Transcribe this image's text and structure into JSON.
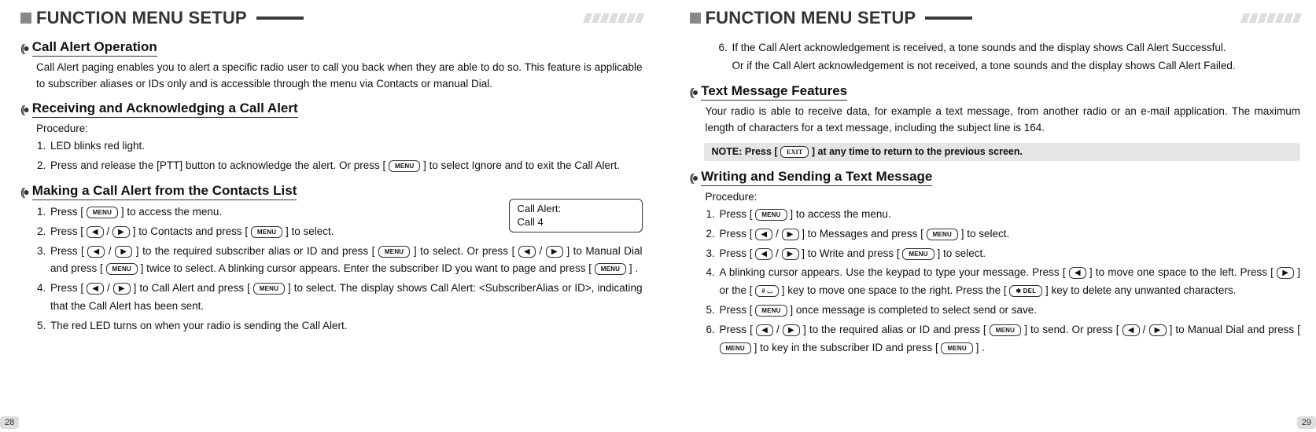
{
  "icons": {
    "menu": "MENU",
    "left": "◀",
    "right": "▶",
    "exit": "EXIT",
    "hash": "# ⌴",
    "star": "✱ DEL"
  },
  "left": {
    "title": "FUNCTION MENU SETUP",
    "page_num": "28",
    "s1": {
      "title": "Call Alert Operation",
      "body": "Call Alert paging enables you to alert a specific radio user to call you back when they are able to do so. This feature is applicable to subscriber aliases or IDs only and is accessible through the menu via Contacts or manual Dial."
    },
    "s2": {
      "title": "Receiving and Acknowledging a Call Alert",
      "proc": "Procedure:",
      "i1": "LED blinks red light.",
      "i2a": "Press and release the [PTT] button to acknowledge the alert. Or press [ ",
      "i2b": " ] to select Ignore and to exit the Call Alert."
    },
    "s3": {
      "title": "Making a Call Alert from the Contacts List",
      "box_l1": "Call Alert:",
      "box_l2": "Call 4",
      "i1a": "Press [ ",
      "i1b": " ] to access the menu.",
      "i2a": "Press [ ",
      "i2b": " / ",
      "i2c": " ] to Contacts and press [ ",
      "i2d": " ] to select.",
      "i3a": "Press [ ",
      "i3b": " / ",
      "i3c": " ] to the required subscriber alias or ID and press [ ",
      "i3d": " ] to select. Or press [ ",
      "i3e": " / ",
      "i3f": " ] to Manual Dial and press [ ",
      "i3g": " ] twice to select. A blinking cursor appears. Enter the subscriber ID you want to page and press [ ",
      "i3h": " ] .",
      "i4a": "Press [ ",
      "i4b": " / ",
      "i4c": " ] to Call Alert and press [ ",
      "i4d": " ] to select. The display shows Call Alert: <SubscriberAlias or ID>, indicating that the Call Alert has been sent.",
      "i5": "The red LED turns on when your radio is sending the Call Alert."
    }
  },
  "right": {
    "title": "FUNCTION MENU SETUP",
    "page_num": "29",
    "top6a": "If the Call Alert acknowledgement is received, a tone sounds and the display shows Call Alert Successful.",
    "top6b": "Or if the Call Alert acknowledgement is not received, a tone sounds and the display shows Call Alert Failed.",
    "s1": {
      "title": "Text Message Features",
      "body": "Your radio is able to receive data, for example a text message, from another radio or an e-mail application. The maximum length of characters for a text message, including the subject line is 164."
    },
    "note_a": "NOTE:  Press [ ",
    "note_b": " ] at any time to return to the previous screen.",
    "s2": {
      "title": "Writing and Sending a Text Message",
      "proc": "Procedure:",
      "i1a": "Press [ ",
      "i1b": " ] to access the menu.",
      "i2a": "Press [ ",
      "i2b": " / ",
      "i2c": " ] to Messages and press [ ",
      "i2d": " ] to select.",
      "i3a": "Press [ ",
      "i3b": " / ",
      "i3c": " ] to Write and press [ ",
      "i3d": " ] to select.",
      "i4a": "A blinking cursor appears. Use the keypad to type your message. Press [ ",
      "i4b": " ] to move one space to the left. Press [ ",
      "i4c": " ] or the [ ",
      "i4d": " ] key to move one space to the right. Press the [ ",
      "i4e": " ] key to delete any unwanted characters.",
      "i5a": "Press [ ",
      "i5b": " ] once message is completed to select send or save.",
      "i6a": "Press [ ",
      "i6b": " / ",
      "i6c": " ] to the required alias or ID and press [ ",
      "i6d": " ] to send. Or press  [ ",
      "i6e": " / ",
      "i6f": " ]  to Manual Dial and press [ ",
      "i6g": " ] to key in the subscriber ID and press [ ",
      "i6h": " ] ."
    }
  }
}
